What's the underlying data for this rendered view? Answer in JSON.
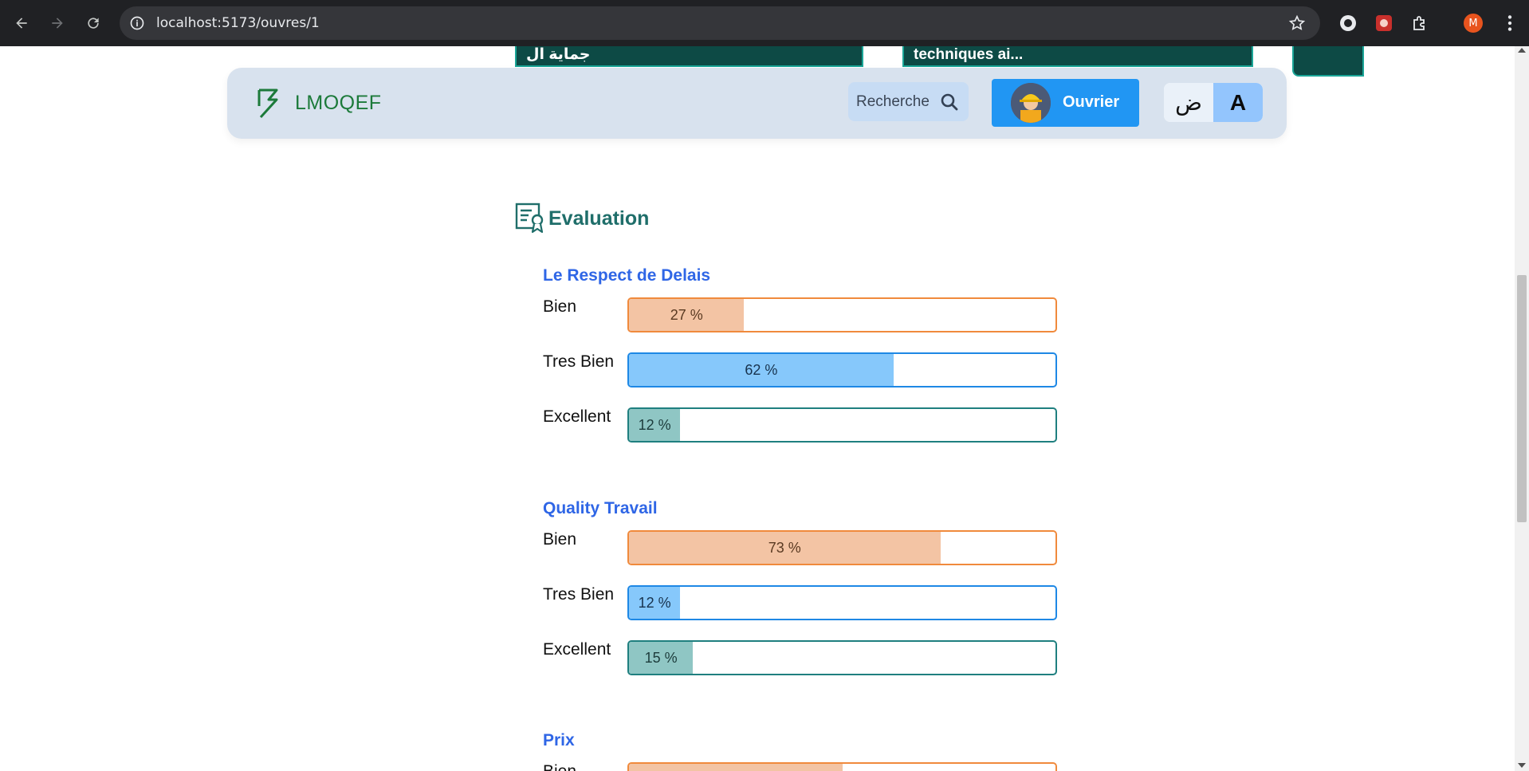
{
  "browser": {
    "url": "localhost:5173/ouvres/1",
    "profile_initial": "M",
    "icons": [
      "back-icon",
      "forward-icon",
      "reload-icon",
      "site-info-icon",
      "bookmark-star-icon",
      "extension-icon",
      "puzzle-icon",
      "kebab-menu-icon"
    ]
  },
  "peek_cards": {
    "left_text": "جماية ال",
    "right_text": "techniques ai..."
  },
  "header": {
    "logo_text": "LMOQEF",
    "search_placeholder": "Recherche",
    "user_button_label": "Ouvrier",
    "lang_ar": "ض",
    "lang_fr": "A",
    "colors": {
      "header_bg": "#d8e2ee",
      "brand_green": "#1c7a3a",
      "primary_blue": "#2196f3",
      "active_lang": "#93c5fd"
    }
  },
  "evaluation": {
    "title": "Evaluation",
    "groups": [
      {
        "title": "Le Respect de Delais",
        "rows": [
          {
            "label": "Bien",
            "percent": 27,
            "text": "27 %"
          },
          {
            "label": "Tres Bien",
            "percent": 62,
            "text": "62 %"
          },
          {
            "label": "Excellent",
            "percent": 12,
            "text": "12 %"
          }
        ]
      },
      {
        "title": "Quality Travail",
        "rows": [
          {
            "label": "Bien",
            "percent": 73,
            "text": "73 %"
          },
          {
            "label": "Tres Bien",
            "percent": 12,
            "text": "12 %"
          },
          {
            "label": "Excellent",
            "percent": 15,
            "text": "15 %"
          }
        ]
      },
      {
        "title": "Prix",
        "rows": [
          {
            "label": "Bien",
            "percent": 50,
            "text": ""
          }
        ]
      }
    ]
  }
}
